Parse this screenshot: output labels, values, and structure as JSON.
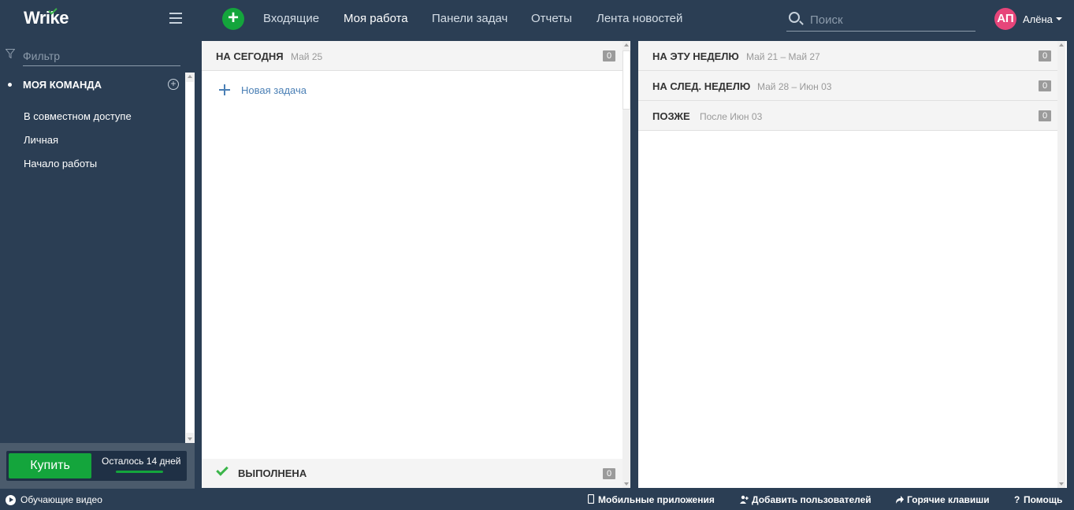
{
  "app": {
    "logo": "Wrike"
  },
  "topbar": {
    "nav": [
      "Входящие",
      "Моя работа",
      "Панели задач",
      "Отчеты",
      "Лента новостей"
    ],
    "search_placeholder": "Поиск",
    "user": {
      "initials": "АП",
      "name": "Алёна"
    }
  },
  "sidebar": {
    "filter_placeholder": "Фильтр",
    "team_label": "МОЯ КОМАНДА",
    "items": [
      "В совместном доступе",
      "Личная",
      "Начало работы"
    ],
    "buy_label": "Купить",
    "trial_text": "Осталось 14 дней",
    "trial_progress": 1
  },
  "today_panel": {
    "title": "НА СЕГОДНЯ",
    "date": "Май 25",
    "count": "0",
    "new_task": "Новая задача",
    "done_title": "ВЫПОЛНЕНА",
    "done_count": "0"
  },
  "groups": [
    {
      "title": "НА ЭТУ НЕДЕЛЮ",
      "date": "Май 21 – Май 27",
      "count": "0"
    },
    {
      "title": "НА СЛЕД. НЕДЕЛЮ",
      "date": "Май 28 – Июн 03",
      "count": "0"
    },
    {
      "title": "ПОЗЖЕ",
      "date": "После Июн 03",
      "count": "0"
    }
  ],
  "footer": {
    "training": "Обучающие видео",
    "mobile": "Мобильные приложения",
    "add_users": "Добавить пользователей",
    "hotkeys": "Горячие клавиши",
    "help": "Помощь"
  }
}
